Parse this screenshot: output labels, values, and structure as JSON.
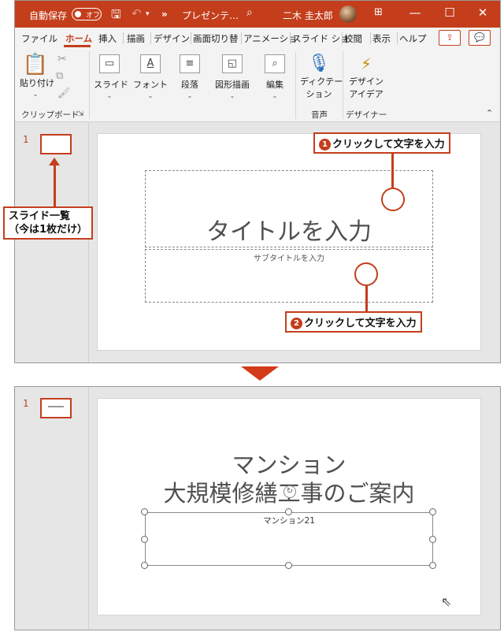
{
  "titlebar": {
    "autosave_label": "自動保存",
    "autosave_state": "オフ",
    "title": "プレゼンテ…",
    "overflow": "»",
    "user_name": "二木 圭太郎"
  },
  "tabs": [
    "ファイル",
    "ホーム",
    "挿入",
    "描画",
    "デザイン",
    "画面切り替",
    "アニメーショ",
    "スライド ショ",
    "校閲",
    "表示",
    "ヘルプ"
  ],
  "ribbon": {
    "paste": "貼り付け",
    "clipboard_group": "クリップボード",
    "slide": "スライド",
    "font": "フォント",
    "paragraph": "段落",
    "drawing": "図形描画",
    "editing": "編集",
    "dictate": "ディクテー\nション",
    "dictate_line1": "ディクテー",
    "dictate_line2": "ション",
    "voice_group": "音声",
    "design_ideas_line1": "デザイン",
    "design_ideas_line2": "アイデア",
    "designer_group": "デザイナー"
  },
  "slide_top": {
    "number": "1",
    "title_placeholder": "タイトルを入力",
    "subtitle_placeholder": "サブタイトルを入力"
  },
  "callouts": {
    "step1": "クリックして文字を入力",
    "step1_badge": "❶",
    "step2": "クリックして文字を入力",
    "step2_badge": "❷",
    "slide_list_line1": "スライド一覧",
    "slide_list_line2": "（今は1枚だけ）"
  },
  "slide_bottom": {
    "number": "1",
    "title_line1": "マンション",
    "title_line2": "大規模修繕工事のご案内",
    "subtitle": "マンション21"
  },
  "colors": {
    "brand": "#c43e1c",
    "arrow": "#d33a17"
  }
}
